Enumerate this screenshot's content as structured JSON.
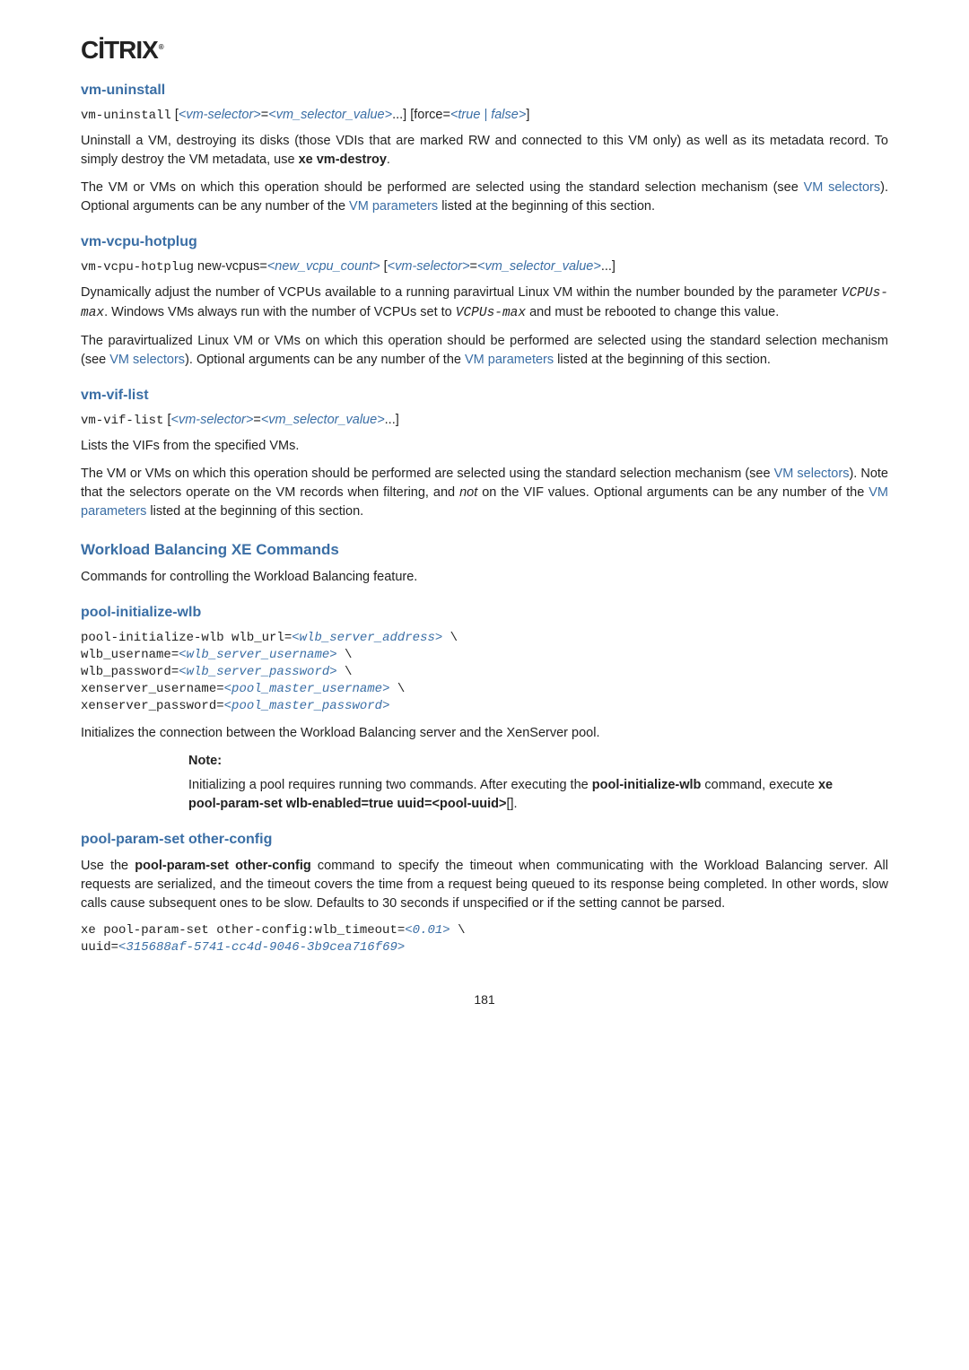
{
  "logo": "CİTRIX",
  "logo_symbol": "®",
  "sections": {
    "vm_uninstall": {
      "heading": "vm-uninstall",
      "syntax_cmd": "vm-uninstall",
      "syntax_rest_1": " [",
      "syntax_sel": "<vm-selector>",
      "syntax_eq": "=",
      "syntax_val": "<vm_selector_value>",
      "syntax_rest_2": "...] [force=",
      "syntax_force": "<true | false>",
      "syntax_rest_3": "]",
      "para1_a": "Uninstall a VM, destroying its disks (those VDIs that are marked RW and connected to this VM only) as well as its metadata record. To simply destroy the VM metadata, use ",
      "para1_b": "xe vm-destroy",
      "para1_c": ".",
      "para2_a": "The VM or VMs on which this operation should be performed are selected using the standard selection mechanism (see ",
      "para2_link1": "VM selectors",
      "para2_b": "). Optional arguments can be any number of the ",
      "para2_link2": "VM parameters",
      "para2_c": " listed at the beginning of this section."
    },
    "vm_vcpu_hotplug": {
      "heading": "vm-vcpu-hotplug",
      "syntax_cmd": "vm-vcpu-hotplug",
      "syntax_rest_1": " new-vcpus=",
      "syntax_count": "<new_vcpu_count>",
      "syntax_rest_2": " [",
      "syntax_sel": "<vm-selector>",
      "syntax_eq": "=",
      "syntax_val": "<vm_selector_value>",
      "syntax_rest_3": "...]",
      "para1_a": "Dynamically adjust the number of VCPUs available to a running paravirtual Linux VM within the number bounded by the parameter ",
      "para1_code1": "VCPUs-max",
      "para1_b": ". Windows VMs always run with the number of VCPUs set to ",
      "para1_code2": "VCPUs-max",
      "para1_c": " and must be rebooted to change this value.",
      "para2_a": "The paravirtualized Linux VM or VMs on which this operation should be performed are selected using the standard selection mechanism (see ",
      "para2_link1": "VM selectors",
      "para2_b": "). Optional arguments can be any number of the ",
      "para2_link2": "VM parameters",
      "para2_c": " listed at the beginning of this section."
    },
    "vm_vif_list": {
      "heading": "vm-vif-list",
      "syntax_cmd": "vm-vif-list",
      "syntax_rest_1": " [",
      "syntax_sel": "<vm-selector>",
      "syntax_eq": "=",
      "syntax_val": "<vm_selector_value>",
      "syntax_rest_2": "...]",
      "para1": "Lists the VIFs from the specified VMs.",
      "para2_a": "The VM or VMs on which this operation should be performed are selected using the standard selection mechanism (see ",
      "para2_link1": "VM selectors",
      "para2_b": "). Note that the selectors operate on the VM records when filtering, and ",
      "para2_not": "not",
      "para2_c": " on the VIF values. Optional arguments can be any number of the ",
      "para2_link2": "VM parameters",
      "para2_d": " listed at the beginning of this section."
    },
    "wlb_section": {
      "heading": "Workload Balancing XE Commands",
      "para1": "Commands for controlling the Workload Balancing feature."
    },
    "pool_initialize_wlb": {
      "heading": "pool-initialize-wlb",
      "code_l1_a": "pool-initialize-wlb wlb_url=",
      "code_l1_b": "<wlb_server_address>",
      "code_l1_c": " \\",
      "code_l2_a": "wlb_username=",
      "code_l2_b": "<wlb_server_username>",
      "code_l2_c": " \\",
      "code_l3_a": "wlb_password=",
      "code_l3_b": "<wlb_server_password>",
      "code_l3_c": " \\",
      "code_l4_a": "xenserver_username=",
      "code_l4_b": "<pool_master_username>",
      "code_l4_c": " \\",
      "code_l5_a": "xenserver_password=",
      "code_l5_b": "<pool_master_password>",
      "para1": "Initializes the connection between the Workload Balancing server and the XenServer pool.",
      "note_label": "Note:",
      "note_a": "Initializing a pool requires running two commands. After executing the ",
      "note_b": "pool-initialize-wlb",
      "note_c": " command, execute ",
      "note_d": "xe pool-param-set wlb-enabled=true uuid=<pool-uuid>",
      "note_e": "[]."
    },
    "pool_param_set": {
      "heading": "pool-param-set other-config",
      "para1_a": "Use the ",
      "para1_b": "pool-param-set other-config",
      "para1_c": " command to specify the timeout when communicating with the Workload Balancing server. All requests are serialized, and the timeout covers the time from a request being queued to its response being completed. In other words, slow calls cause subsequent ones to be slow. Defaults to 30 seconds if unspecified or if the setting cannot be parsed.",
      "code_l1_a": "xe pool-param-set other-config:wlb_timeout=",
      "code_l1_b": "<0.01>",
      "code_l1_c": " \\",
      "code_l2_a": "uuid=",
      "code_l2_b": "<315688af-5741-cc4d-9046-3b9cea716f69>"
    }
  },
  "page_number": "181"
}
